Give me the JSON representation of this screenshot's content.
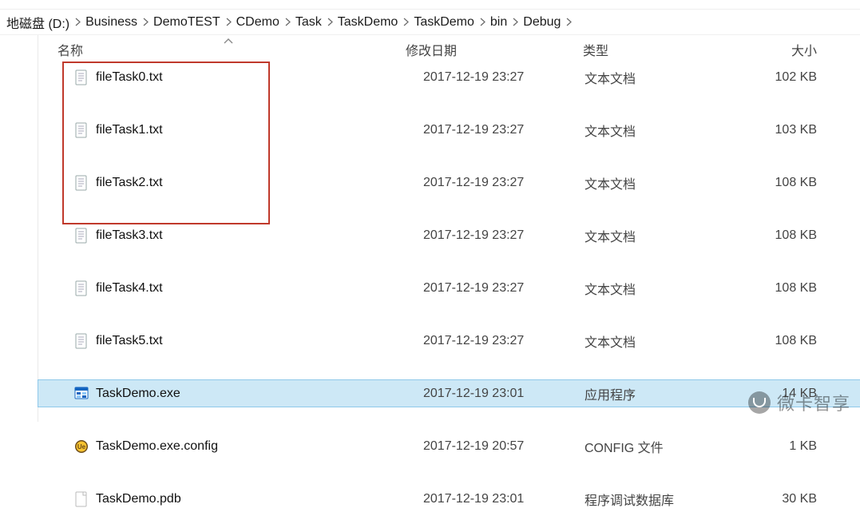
{
  "toolbar_fragments": [],
  "breadcrumb": {
    "items": [
      "地磁盘 (D:)",
      "Business",
      "DemoTEST",
      "CDemo",
      "Task",
      "TaskDemo",
      "TaskDemo",
      "bin",
      "Debug"
    ]
  },
  "columns": {
    "name": "名称",
    "modified": "修改日期",
    "type": "类型",
    "size": "大小"
  },
  "files": [
    {
      "icon": "txt",
      "name": "fileTask0.txt",
      "modified": "2017-12-19 23:27",
      "type": "文本文档",
      "size": "102 KB",
      "highlight": true,
      "selected": false
    },
    {
      "icon": "txt",
      "name": "fileTask1.txt",
      "modified": "2017-12-19 23:27",
      "type": "文本文档",
      "size": "103 KB",
      "highlight": true,
      "selected": false
    },
    {
      "icon": "txt",
      "name": "fileTask2.txt",
      "modified": "2017-12-19 23:27",
      "type": "文本文档",
      "size": "108 KB",
      "highlight": true,
      "selected": false
    },
    {
      "icon": "txt",
      "name": "fileTask3.txt",
      "modified": "2017-12-19 23:27",
      "type": "文本文档",
      "size": "108 KB",
      "highlight": true,
      "selected": false
    },
    {
      "icon": "txt",
      "name": "fileTask4.txt",
      "modified": "2017-12-19 23:27",
      "type": "文本文档",
      "size": "108 KB",
      "highlight": true,
      "selected": false
    },
    {
      "icon": "txt",
      "name": "fileTask5.txt",
      "modified": "2017-12-19 23:27",
      "type": "文本文档",
      "size": "108 KB",
      "highlight": true,
      "selected": false
    },
    {
      "icon": "exe",
      "name": "TaskDemo.exe",
      "modified": "2017-12-19 23:01",
      "type": "应用程序",
      "size": "14 KB",
      "highlight": false,
      "selected": true
    },
    {
      "icon": "ue",
      "name": "TaskDemo.exe.config",
      "modified": "2017-12-19 20:57",
      "type": "CONFIG 文件",
      "size": "1 KB",
      "highlight": false,
      "selected": false
    },
    {
      "icon": "gen",
      "name": "TaskDemo.pdb",
      "modified": "2017-12-19 23:01",
      "type": "程序调试数据库",
      "size": "30 KB",
      "highlight": false,
      "selected": false
    }
  ],
  "watermark": "微卡智享"
}
